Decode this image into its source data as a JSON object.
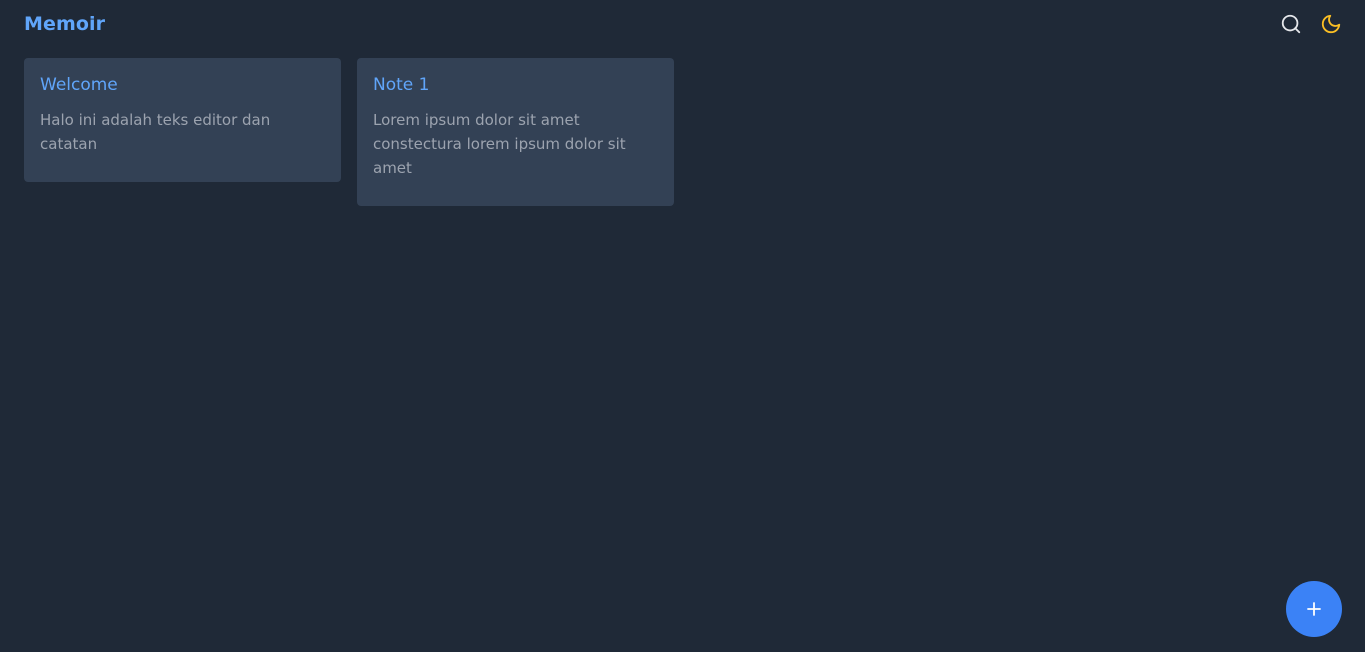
{
  "header": {
    "title": "Memoir",
    "icons": {
      "search": "search-icon",
      "theme": "moon-icon"
    },
    "colors": {
      "accent": "#60a5fa",
      "theme_icon": "#fbbf24",
      "search_icon": "#e5e7eb"
    }
  },
  "notes": [
    {
      "title": "Welcome",
      "body": "Halo ini adalah teks editor dan catatan"
    },
    {
      "title": "Note 1",
      "body": "Lorem ipsum dolor sit amet constectura lorem ipsum dolor sit amet"
    }
  ],
  "fab": {
    "icon": "plus-icon",
    "color": "#3b82f6"
  },
  "colors": {
    "background": "#1f2937",
    "card": "#334155",
    "body_text": "#9ca3af"
  }
}
